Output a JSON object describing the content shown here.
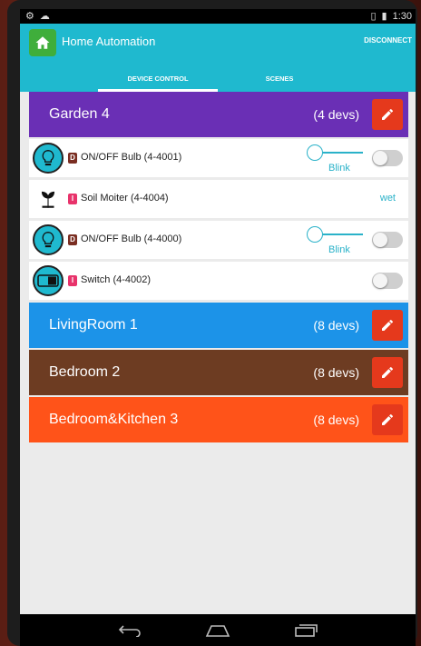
{
  "status_bar": {
    "time": "1:30"
  },
  "app": {
    "title": "Home Automation",
    "disconnect_label": "DISCONNECT"
  },
  "tabs": [
    {
      "label": "DEVICE CONTROL",
      "active": true
    },
    {
      "label": "SCENES",
      "active": false
    }
  ],
  "groups": [
    {
      "name": "Garden 4",
      "count": "(4 devs)",
      "color": "#6a2fb5",
      "devices": [
        {
          "badge": "D",
          "badge_color": "#7a2e22",
          "label": "ON/OFF Bulb (4-4001)",
          "icon": "lightbulb-icon",
          "blink_label": "Blink",
          "toggle": false
        },
        {
          "badge": "I",
          "badge_color": "#e8336b",
          "label": "Soil Moiter (4-4004)",
          "icon": "plant-icon",
          "value": "wet"
        },
        {
          "badge": "D",
          "badge_color": "#7a2e22",
          "label": "ON/OFF Bulb (4-4000)",
          "icon": "lightbulb-icon",
          "blink_label": "Blink",
          "toggle": false
        },
        {
          "badge": "I",
          "badge_color": "#e8336b",
          "label": "Switch (4-4002)",
          "icon": "switch-icon",
          "toggle": false
        }
      ]
    },
    {
      "name": "LivingRoom 1",
      "count": "(8 devs)",
      "color": "#1c93e8"
    },
    {
      "name": "Bedroom 2",
      "count": "(8 devs)",
      "color": "#6d3c22"
    },
    {
      "name": "Bedroom&Kitchen 3",
      "count": "(8 devs)",
      "color": "#ff5319"
    }
  ],
  "colors": {
    "accent": "#1fb9cf",
    "edit_button": "#e5391c"
  }
}
